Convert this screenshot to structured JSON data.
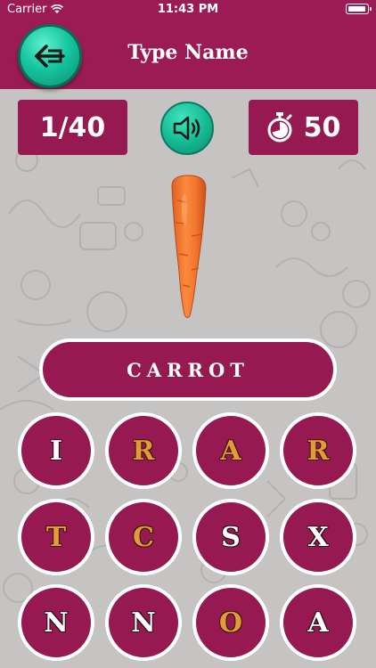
{
  "status_bar": {
    "carrier": "Carrier",
    "time": "11:43 PM"
  },
  "header": {
    "title": "Type Name",
    "back_icon": "arrow-left-icon"
  },
  "progress": {
    "counter": "1/40"
  },
  "sound": {
    "icon": "speaker-icon"
  },
  "timer": {
    "icon": "stopwatch-icon",
    "value": "50"
  },
  "question": {
    "image": "carrot",
    "answer": "CARROT"
  },
  "colors": {
    "primary": "#961a51",
    "accent": "#14b891",
    "highlight_letter": "#e49a3a"
  },
  "letters": [
    {
      "char": "I",
      "style": "white"
    },
    {
      "char": "R",
      "style": "orange"
    },
    {
      "char": "A",
      "style": "orange"
    },
    {
      "char": "R",
      "style": "orange"
    },
    {
      "char": "T",
      "style": "orange"
    },
    {
      "char": "C",
      "style": "orange"
    },
    {
      "char": "S",
      "style": "white"
    },
    {
      "char": "X",
      "style": "white"
    },
    {
      "char": "N",
      "style": "white"
    },
    {
      "char": "N",
      "style": "white"
    },
    {
      "char": "O",
      "style": "orange"
    },
    {
      "char": "A",
      "style": "white"
    }
  ]
}
